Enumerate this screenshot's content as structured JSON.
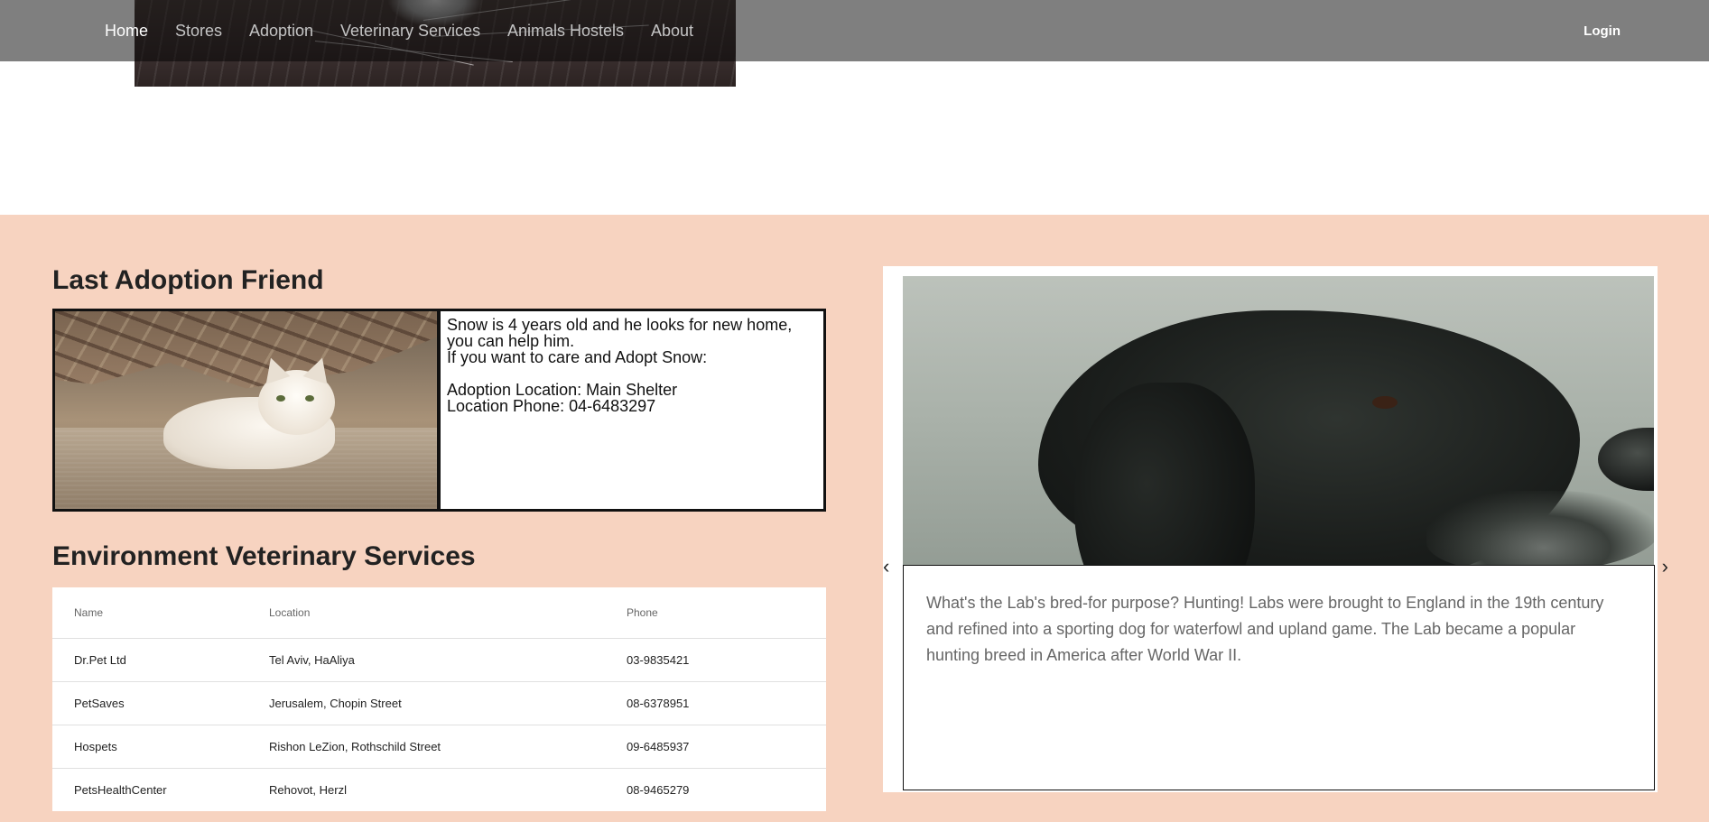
{
  "nav": {
    "items": [
      {
        "label": "Home",
        "active": true
      },
      {
        "label": "Stores",
        "active": false
      },
      {
        "label": "Adoption",
        "active": false
      },
      {
        "label": "Veterinary Services",
        "active": false
      },
      {
        "label": "Animals Hostels",
        "active": false
      },
      {
        "label": "About",
        "active": false
      }
    ],
    "login_label": "Login"
  },
  "adoption": {
    "title": "Last Adoption Friend",
    "lines": [
      "Snow is 4 years old and he looks for new home,",
      "you can help him.",
      "If you want to care and Adopt Snow:"
    ],
    "location": "Adoption Location: Main Shelter",
    "phone": "Location Phone: 04-6483297"
  },
  "vet": {
    "title": "Environment Veterinary Services",
    "headers": {
      "name": "Name",
      "location": "Location",
      "phone": "Phone"
    },
    "rows": [
      {
        "name": "Dr.Pet Ltd",
        "location": "Tel Aviv, HaAliya",
        "phone": "03-9835421"
      },
      {
        "name": "PetSaves",
        "location": "Jerusalem, Chopin Street",
        "phone": "08-6378951"
      },
      {
        "name": "Hospets",
        "location": "Rishon LeZion, Rothschild Street",
        "phone": "09-6485937"
      },
      {
        "name": "PetsHealthCenter",
        "location": "Rehovot, Herzl",
        "phone": "08-9465279"
      }
    ]
  },
  "carousel": {
    "caption": "What's the Lab's bred-for purpose?  Hunting! Labs were brought to England in the 19th century and refined into a sporting dog for waterfowl and upland game.  The Lab became a popular hunting breed in America after World War II.",
    "prev_icon": "chevron-left-icon",
    "next_icon": "chevron-right-icon"
  },
  "colors": {
    "section_bg": "#f7d3c0",
    "navbar_bg": "rgba(0,0,0,0.5)"
  }
}
